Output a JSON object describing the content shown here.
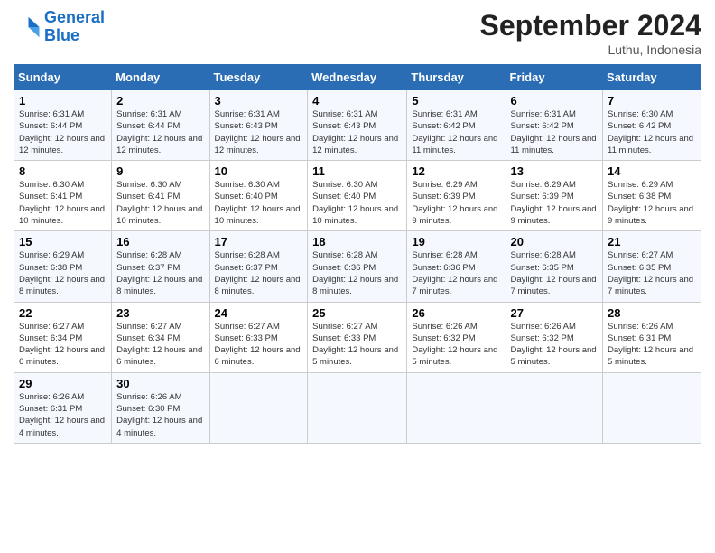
{
  "logo": {
    "line1": "General",
    "line2": "Blue"
  },
  "title": "September 2024",
  "location": "Luthu, Indonesia",
  "days_of_week": [
    "Sunday",
    "Monday",
    "Tuesday",
    "Wednesday",
    "Thursday",
    "Friday",
    "Saturday"
  ],
  "weeks": [
    [
      {
        "day": "1",
        "sunrise": "6:31 AM",
        "sunset": "6:44 PM",
        "daylight": "12 hours and 12 minutes."
      },
      {
        "day": "2",
        "sunrise": "6:31 AM",
        "sunset": "6:44 PM",
        "daylight": "12 hours and 12 minutes."
      },
      {
        "day": "3",
        "sunrise": "6:31 AM",
        "sunset": "6:43 PM",
        "daylight": "12 hours and 12 minutes."
      },
      {
        "day": "4",
        "sunrise": "6:31 AM",
        "sunset": "6:43 PM",
        "daylight": "12 hours and 12 minutes."
      },
      {
        "day": "5",
        "sunrise": "6:31 AM",
        "sunset": "6:42 PM",
        "daylight": "12 hours and 11 minutes."
      },
      {
        "day": "6",
        "sunrise": "6:31 AM",
        "sunset": "6:42 PM",
        "daylight": "12 hours and 11 minutes."
      },
      {
        "day": "7",
        "sunrise": "6:30 AM",
        "sunset": "6:42 PM",
        "daylight": "12 hours and 11 minutes."
      }
    ],
    [
      {
        "day": "8",
        "sunrise": "6:30 AM",
        "sunset": "6:41 PM",
        "daylight": "12 hours and 10 minutes."
      },
      {
        "day": "9",
        "sunrise": "6:30 AM",
        "sunset": "6:41 PM",
        "daylight": "12 hours and 10 minutes."
      },
      {
        "day": "10",
        "sunrise": "6:30 AM",
        "sunset": "6:40 PM",
        "daylight": "12 hours and 10 minutes."
      },
      {
        "day": "11",
        "sunrise": "6:30 AM",
        "sunset": "6:40 PM",
        "daylight": "12 hours and 10 minutes."
      },
      {
        "day": "12",
        "sunrise": "6:29 AM",
        "sunset": "6:39 PM",
        "daylight": "12 hours and 9 minutes."
      },
      {
        "day": "13",
        "sunrise": "6:29 AM",
        "sunset": "6:39 PM",
        "daylight": "12 hours and 9 minutes."
      },
      {
        "day": "14",
        "sunrise": "6:29 AM",
        "sunset": "6:38 PM",
        "daylight": "12 hours and 9 minutes."
      }
    ],
    [
      {
        "day": "15",
        "sunrise": "6:29 AM",
        "sunset": "6:38 PM",
        "daylight": "12 hours and 8 minutes."
      },
      {
        "day": "16",
        "sunrise": "6:28 AM",
        "sunset": "6:37 PM",
        "daylight": "12 hours and 8 minutes."
      },
      {
        "day": "17",
        "sunrise": "6:28 AM",
        "sunset": "6:37 PM",
        "daylight": "12 hours and 8 minutes."
      },
      {
        "day": "18",
        "sunrise": "6:28 AM",
        "sunset": "6:36 PM",
        "daylight": "12 hours and 8 minutes."
      },
      {
        "day": "19",
        "sunrise": "6:28 AM",
        "sunset": "6:36 PM",
        "daylight": "12 hours and 7 minutes."
      },
      {
        "day": "20",
        "sunrise": "6:28 AM",
        "sunset": "6:35 PM",
        "daylight": "12 hours and 7 minutes."
      },
      {
        "day": "21",
        "sunrise": "6:27 AM",
        "sunset": "6:35 PM",
        "daylight": "12 hours and 7 minutes."
      }
    ],
    [
      {
        "day": "22",
        "sunrise": "6:27 AM",
        "sunset": "6:34 PM",
        "daylight": "12 hours and 6 minutes."
      },
      {
        "day": "23",
        "sunrise": "6:27 AM",
        "sunset": "6:34 PM",
        "daylight": "12 hours and 6 minutes."
      },
      {
        "day": "24",
        "sunrise": "6:27 AM",
        "sunset": "6:33 PM",
        "daylight": "12 hours and 6 minutes."
      },
      {
        "day": "25",
        "sunrise": "6:27 AM",
        "sunset": "6:33 PM",
        "daylight": "12 hours and 5 minutes."
      },
      {
        "day": "26",
        "sunrise": "6:26 AM",
        "sunset": "6:32 PM",
        "daylight": "12 hours and 5 minutes."
      },
      {
        "day": "27",
        "sunrise": "6:26 AM",
        "sunset": "6:32 PM",
        "daylight": "12 hours and 5 minutes."
      },
      {
        "day": "28",
        "sunrise": "6:26 AM",
        "sunset": "6:31 PM",
        "daylight": "12 hours and 5 minutes."
      }
    ],
    [
      {
        "day": "29",
        "sunrise": "6:26 AM",
        "sunset": "6:31 PM",
        "daylight": "12 hours and 4 minutes."
      },
      {
        "day": "30",
        "sunrise": "6:26 AM",
        "sunset": "6:30 PM",
        "daylight": "12 hours and 4 minutes."
      },
      null,
      null,
      null,
      null,
      null
    ]
  ]
}
